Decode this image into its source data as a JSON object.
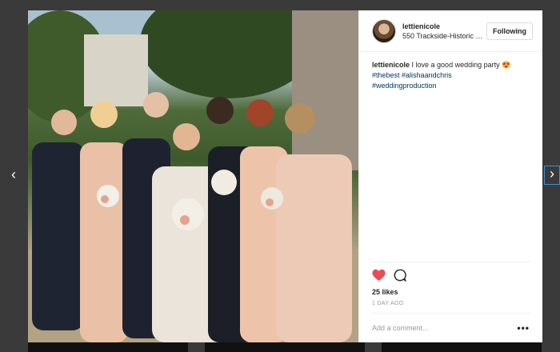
{
  "post": {
    "username": "lettienicole",
    "location": "550 Trackside-Historic Venue",
    "follow_label": "Following",
    "caption_user": "lettienicole",
    "caption_text": "I love a good wedding party 😍",
    "hashtags": [
      "#thebest",
      "#alishaandchris",
      "#weddingproduction"
    ],
    "likes": "25 likes",
    "time_ago": "1 DAY AGO",
    "comment_placeholder": "Add a comment...",
    "more_label": "•••"
  },
  "nav": {
    "prev_label": "‹",
    "next_label": "›"
  },
  "icons": [
    "heart-icon",
    "comment-icon",
    "more-icon",
    "chevron-left-icon",
    "chevron-right-icon"
  ],
  "colors": {
    "heart": "#ed4956",
    "hashtag": "#003569",
    "backdrop": "#3a3a3a"
  }
}
